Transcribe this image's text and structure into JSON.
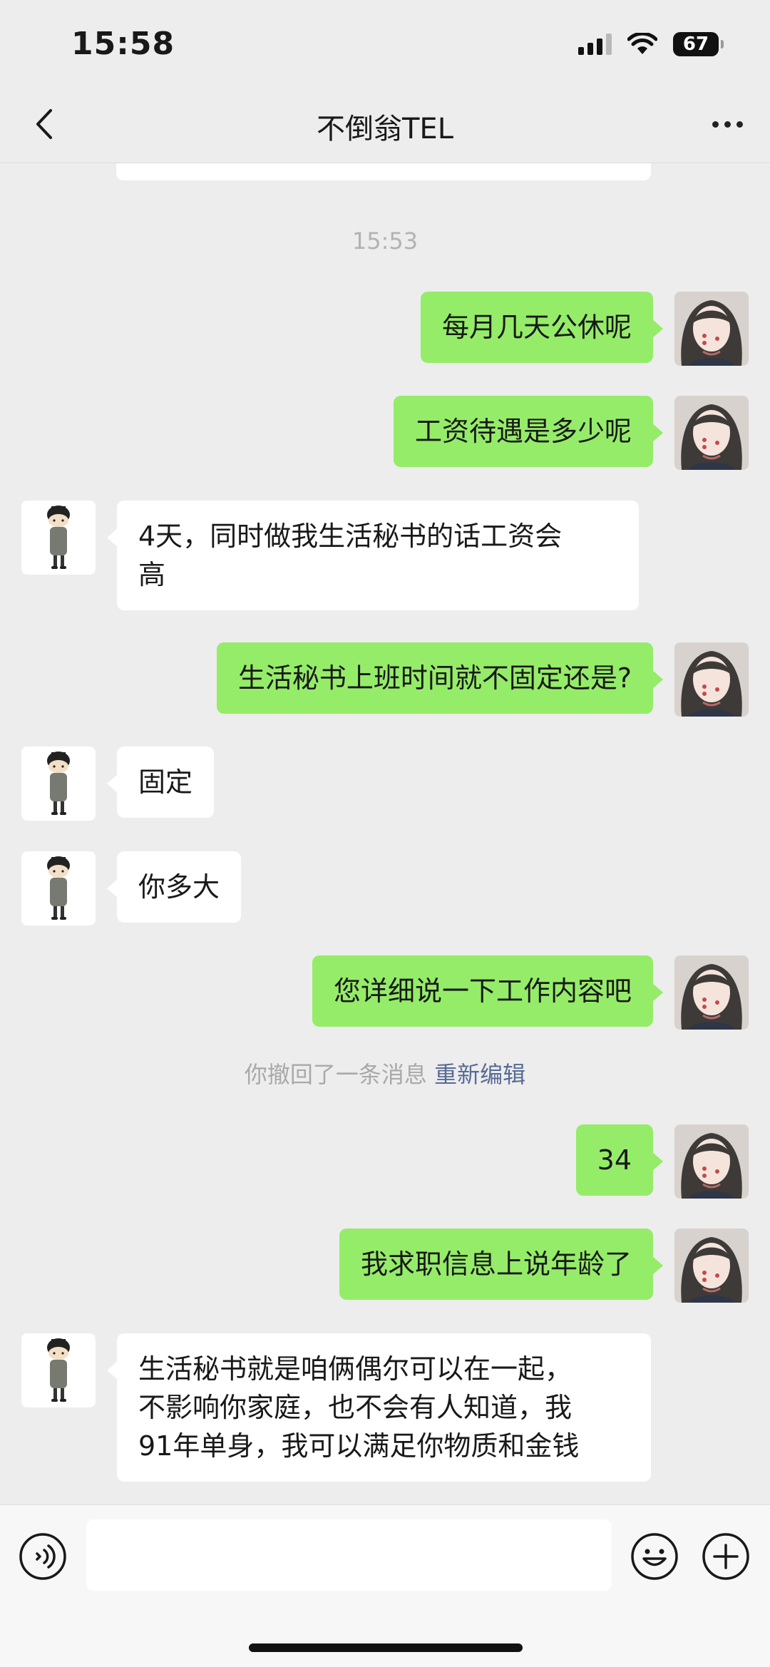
{
  "status_bar": {
    "time": "15:58",
    "battery": "67"
  },
  "nav": {
    "title": "不倒翁TEL"
  },
  "messages": {
    "timestamp": "15:53",
    "m1": "每月几天公休呢",
    "m2": "工资待遇是多少呢",
    "m3_line1": "4天，同时做我生活秘书的话工资会",
    "m3_line2": "高",
    "m4": "生活秘书上班时间就不固定还是?",
    "m5": "固定",
    "m6": "你多大",
    "m7": "您详细说一下工作内容吧",
    "recall_text": "你撤回了一条消息",
    "recall_link": "重新编辑",
    "m8": "34",
    "m9": "我求职信息上说年龄了",
    "m10_line1": "生活秘书就是咱俩偶尔可以在一起，",
    "m10_line2": "不影响你家庭，也不会有人知道，我",
    "m10_line3": "91年单身，我可以满足你物质和金钱"
  },
  "input": {
    "value": ""
  },
  "icons": {
    "back": "chevron-left-icon",
    "more": "more-dots-icon",
    "voice": "voice-icon",
    "emoji": "emoji-icon",
    "plus": "plus-icon"
  },
  "colors": {
    "background": "#ededed",
    "my_bubble": "#95ec69",
    "their_bubble": "#ffffff",
    "link": "#576b95"
  }
}
